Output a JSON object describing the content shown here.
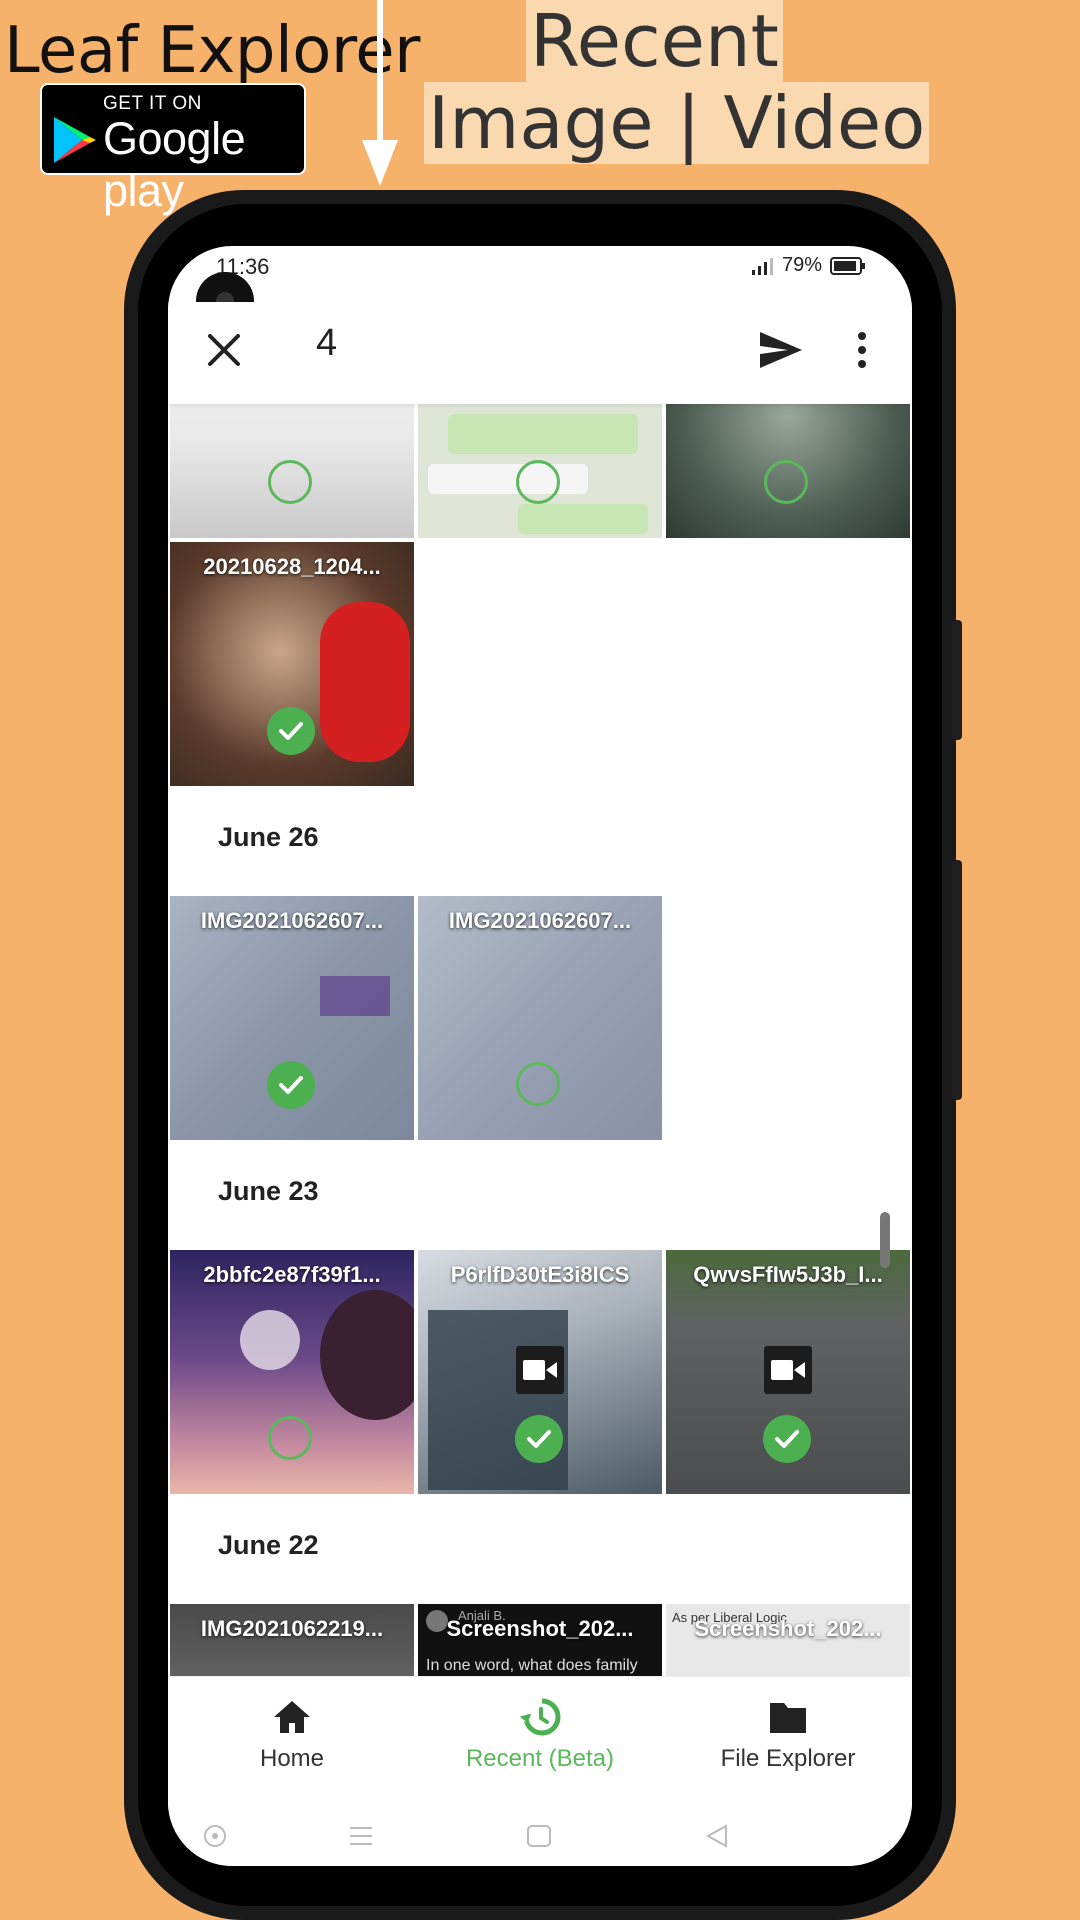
{
  "promo": {
    "app_name": "Leaf Explorer",
    "badge_small": "GET IT ON",
    "badge_big": "Google play",
    "headline_line1": "Recent",
    "headline_line2": "Image | Video"
  },
  "status_bar": {
    "time": "11:36",
    "battery": "79%"
  },
  "toolbar": {
    "selected_count": "4"
  },
  "groups": [
    {
      "date": "",
      "tiles": [
        {
          "label": "",
          "selected": false
        },
        {
          "label": "",
          "selected": false
        },
        {
          "label": "",
          "selected": false
        },
        {
          "label": "20210628_1204...",
          "selected": true
        }
      ]
    },
    {
      "date": "June 26",
      "tiles": [
        {
          "label": "IMG2021062607...",
          "selected": true
        },
        {
          "label": "IMG2021062607...",
          "selected": false
        }
      ]
    },
    {
      "date": "June 23",
      "tiles": [
        {
          "label": "2bbfc2e87f39f1...",
          "selected": false,
          "video": false
        },
        {
          "label": "P6rlfD30tE3i8ICS",
          "selected": true,
          "video": true
        },
        {
          "label": "QwvsFfIw5J3b_I...",
          "selected": true,
          "video": true
        }
      ]
    },
    {
      "date": "June 22",
      "tiles": [
        {
          "label": "IMG2021062219..."
        },
        {
          "label": "Screenshot_202...",
          "caption": "In one word, what does family mean to you?",
          "author": "Anjali B."
        },
        {
          "label": "Screenshot_202...",
          "caption": "As per Liberal Logic"
        }
      ]
    }
  ],
  "bottom_nav": {
    "items": [
      {
        "label": "Home"
      },
      {
        "label": "Recent (Beta)"
      },
      {
        "label": "File Explorer"
      }
    ]
  },
  "colors": {
    "background": "#F6B26B",
    "accent": "#4CAF50"
  }
}
